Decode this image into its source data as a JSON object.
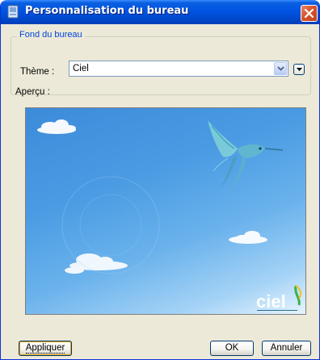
{
  "window": {
    "title": "Personnalisation du bureau",
    "app_icon": "desk-icon",
    "close_icon": "close-icon"
  },
  "group": {
    "legend": "Fond du bureau"
  },
  "theme": {
    "label": "Thème :",
    "value": "Ciel",
    "dropdown_icon": "chevron-down-icon"
  },
  "preview": {
    "label": "Aperçu :",
    "logo_text": "ciel",
    "image": "blue sky with clouds and hummingbird"
  },
  "buttons": {
    "apply": "Appliquer",
    "ok": "OK",
    "cancel": "Annuler"
  },
  "colors": {
    "titlebar": "#0054E3",
    "dialog_bg": "#ECE9D8",
    "legend": "#0046D5",
    "close": "#D9532C"
  }
}
